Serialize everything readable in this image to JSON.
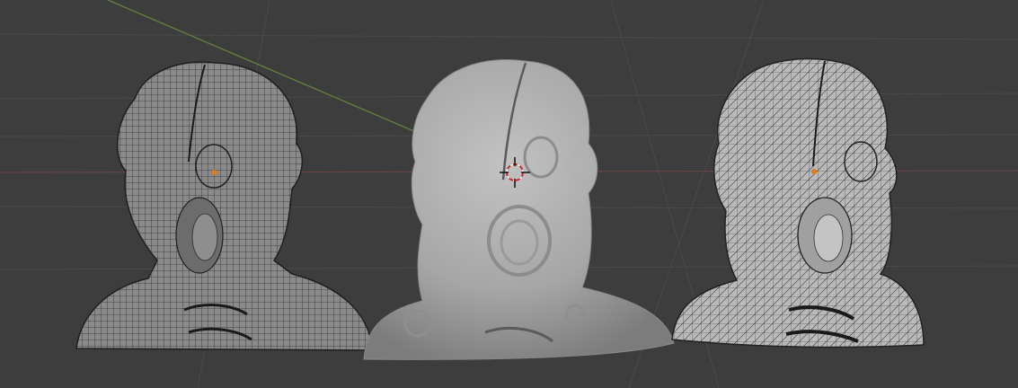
{
  "viewport": {
    "background_color": "#3d3d3d",
    "grid_color": "#4a4a4a",
    "x_axis_color": "#6e4646",
    "y_axis_color": "#5f7f3a"
  },
  "objects": [
    {
      "name": "left-head-wireframe",
      "display": "wireframe-dense",
      "surface_color": "#8a8a8a",
      "wire_color": "#2e2e2e",
      "origin_color": "#e07b1a"
    },
    {
      "name": "center-head-solid",
      "display": "solid",
      "surface_color": "#a8a8a8",
      "wire_color": "",
      "origin_color": ""
    },
    {
      "name": "right-head-wireframe",
      "display": "wireframe-remesh",
      "surface_color": "#b9b9b9",
      "wire_color": "#3a3a3a",
      "origin_color": "#e07b1a"
    }
  ],
  "cursor": {
    "icon": "3d-cursor-icon",
    "ring_color": "#cc2a2a"
  }
}
